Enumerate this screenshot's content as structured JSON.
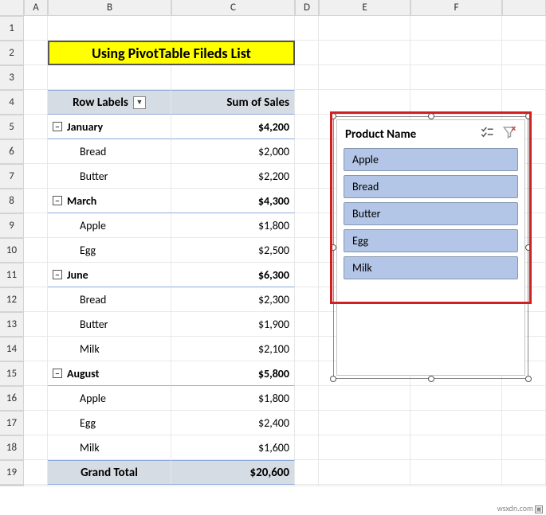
{
  "columns": [
    "A",
    "B",
    "C",
    "D",
    "E",
    "F"
  ],
  "rows_count": 19,
  "title": "Using PivotTable Fileds List",
  "pivot": {
    "row_label_header": "Row Labels",
    "value_header": "Sum of Sales",
    "grand_label": "Grand Total",
    "grand_value": "$20,600",
    "groups": [
      {
        "name": "January",
        "subtotal": "$4,200",
        "items": [
          {
            "name": "Bread",
            "value": "$2,000"
          },
          {
            "name": "Butter",
            "value": "$2,200"
          }
        ]
      },
      {
        "name": "March",
        "subtotal": "$4,300",
        "items": [
          {
            "name": "Apple",
            "value": "$1,800"
          },
          {
            "name": "Egg",
            "value": "$2,500"
          }
        ]
      },
      {
        "name": "June",
        "subtotal": "$6,300",
        "items": [
          {
            "name": "Bread",
            "value": "$2,300"
          },
          {
            "name": "Butter",
            "value": "$1,900"
          },
          {
            "name": "Milk",
            "value": "$2,100"
          }
        ]
      },
      {
        "name": "August",
        "subtotal": "$5,800",
        "items": [
          {
            "name": "Apple",
            "value": "$1,800"
          },
          {
            "name": "Egg",
            "value": "$2,400"
          },
          {
            "name": "Milk",
            "value": "$1,600"
          }
        ]
      }
    ]
  },
  "slicer": {
    "title": "Product Name",
    "items": [
      "Apple",
      "Bread",
      "Butter",
      "Egg",
      "Milk"
    ]
  },
  "watermark": "wsxdn.com"
}
